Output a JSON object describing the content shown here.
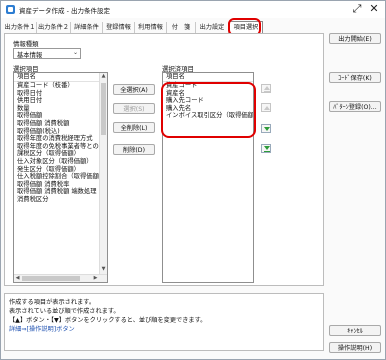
{
  "window": {
    "title": "資産データ作成 - 出力条件設定"
  },
  "tabs": [
    "出力条件１",
    "出力条件２",
    "詳細条件",
    "登録情報",
    "利用情報",
    "付　箋",
    "出力設定",
    "項目選択"
  ],
  "active_tab": "項目選択",
  "info_type": {
    "label": "情報種類",
    "value": "基本情報"
  },
  "available": {
    "label": "選択項目",
    "header": "項目名",
    "items": [
      "資産コード（枝番）",
      "取得日付",
      "供用日付",
      "数量",
      "取得価額",
      "取得価額 消費税額",
      "取得価額(税込)",
      "取得年度の消費税経理方式",
      "取得年度の免税事業者等との取",
      "課税区分（取得価額）",
      "仕入対象区分（取得価額）",
      "発生区分（取得価額）",
      "仕入税額控除割合（取得価額）",
      "取得価額 消費税率",
      "取得価額 消費税額 端数処理",
      "消費税区分"
    ]
  },
  "selected": {
    "label": "選択済項目",
    "header": "項目名",
    "items": [
      "資産コード",
      "資産名",
      "購入先コード",
      "購入先名",
      "インボイス取引区分（取得価額）"
    ]
  },
  "buttons": {
    "select_all": "全選択(A)",
    "select": "選択(S)",
    "delete_all": "全削除(L)",
    "delete": "削除(D)"
  },
  "side": {
    "output_start": "出力開始(E)",
    "code_save": "ｺｰﾄﾞ保存(K)",
    "pattern_register": "ﾊﾟﾀｰﾝ登録(O)...",
    "cancel": "ｷｬﾝｾﾙ",
    "help": "操作説明(H)"
  },
  "info_text": [
    "作成する項目が表示されます。",
    "表示されている並び順で作成されます。",
    "【▲】ボタン・【▼】ボタンをクリックすると、並び順を変更できます。",
    "詳細⇒[操作説明]ボタン"
  ],
  "colors": {
    "highlight": "#e00000",
    "move_arrow": "#2e9b3a",
    "link": "#1c4fb0"
  }
}
